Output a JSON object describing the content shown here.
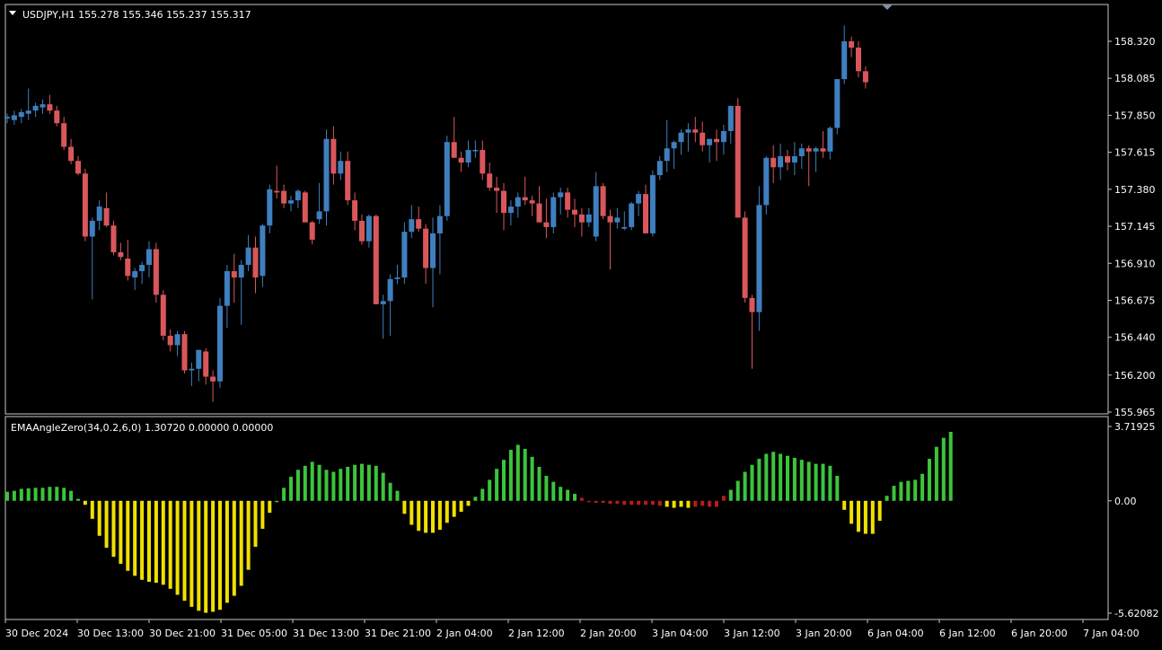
{
  "colors": {
    "background": "#000000",
    "frame": "#c8c8c8",
    "text": "#ffffff",
    "candle_up": "#3f7fbf",
    "candle_down": "#d9575b",
    "hist_green": "#3cc43c",
    "hist_yellow": "#f0e000",
    "hist_red": "#b41c1c"
  },
  "header": {
    "main_title": "USDJPY,H1  155.278 155.346 155.237 155.317",
    "indicator_title": "EMAAngleZero(34,0.2,6,0) 1.30720 0.00000 0.00000"
  },
  "chart_data": [
    {
      "type": "candlestick",
      "title": "USDJPY,H1  155.278 155.346 155.237 155.317",
      "ylim": [
        155.965,
        158.32
      ],
      "y_ticks": [
        "158.320",
        "158.085",
        "157.850",
        "157.615",
        "157.380",
        "157.145",
        "156.910",
        "156.675",
        "156.440",
        "156.200",
        "155.965"
      ],
      "x_ticks": [
        "30 Dec 2024",
        "30 Dec 13:00",
        "30 Dec 21:00",
        "31 Dec 05:00",
        "31 Dec 13:00",
        "31 Dec 21:00",
        "2 Jan 04:00",
        "2 Jan 12:00",
        "2 Jan 20:00",
        "3 Jan 04:00",
        "3 Jan 12:00",
        "3 Jan 20:00",
        "6 Jan 04:00",
        "6 Jan 12:00",
        "6 Jan 20:00",
        "7 Jan 04:00"
      ],
      "ohlc": [
        [
          157.83,
          157.86,
          157.8,
          157.84
        ],
        [
          157.82,
          157.88,
          157.79,
          157.85
        ],
        [
          157.84,
          157.89,
          157.8,
          157.87
        ],
        [
          157.86,
          158.02,
          157.82,
          157.88
        ],
        [
          157.88,
          157.93,
          157.84,
          157.91
        ],
        [
          157.9,
          157.95,
          157.86,
          157.92
        ],
        [
          157.92,
          157.98,
          157.86,
          157.88
        ],
        [
          157.88,
          157.91,
          157.78,
          157.8
        ],
        [
          157.8,
          157.84,
          157.63,
          157.65
        ],
        [
          157.65,
          157.7,
          157.54,
          157.56
        ],
        [
          157.56,
          157.59,
          157.47,
          157.48
        ],
        [
          157.48,
          157.51,
          157.05,
          157.08
        ],
        [
          157.08,
          157.2,
          156.68,
          157.18
        ],
        [
          157.18,
          157.31,
          157.12,
          157.27
        ],
        [
          157.26,
          157.36,
          157.14,
          157.15
        ],
        [
          157.15,
          157.18,
          156.96,
          156.98
        ],
        [
          156.98,
          157.04,
          156.93,
          156.95
        ],
        [
          156.94,
          157.06,
          156.8,
          156.83
        ],
        [
          156.82,
          156.88,
          156.74,
          156.86
        ],
        [
          156.86,
          156.92,
          156.78,
          156.9
        ],
        [
          156.9,
          157.05,
          156.82,
          157.0
        ],
        [
          157.0,
          157.04,
          156.66,
          156.71
        ],
        [
          156.71,
          156.74,
          156.42,
          156.45
        ],
        [
          156.45,
          156.49,
          156.35,
          156.39
        ],
        [
          156.39,
          156.48,
          156.32,
          156.46
        ],
        [
          156.46,
          156.48,
          156.21,
          156.23
        ],
        [
          156.23,
          156.28,
          156.13,
          156.24
        ],
        [
          156.24,
          156.36,
          156.16,
          156.36
        ],
        [
          156.35,
          156.37,
          156.14,
          156.19
        ],
        [
          156.19,
          156.23,
          156.03,
          156.16
        ],
        [
          156.16,
          156.69,
          156.12,
          156.64
        ],
        [
          156.64,
          156.9,
          156.5,
          156.86
        ],
        [
          156.86,
          156.97,
          156.66,
          156.82
        ],
        [
          156.82,
          156.93,
          156.52,
          156.9
        ],
        [
          156.9,
          157.09,
          156.86,
          157.01
        ],
        [
          157.01,
          157.08,
          156.72,
          156.82
        ],
        [
          156.83,
          157.16,
          156.76,
          157.15
        ],
        [
          157.15,
          157.41,
          157.1,
          157.38
        ],
        [
          157.37,
          157.53,
          157.32,
          157.36
        ],
        [
          157.37,
          157.41,
          157.26,
          157.29
        ],
        [
          157.29,
          157.34,
          157.24,
          157.31
        ],
        [
          157.31,
          157.38,
          157.26,
          157.37
        ],
        [
          157.36,
          157.37,
          157.17,
          157.17
        ],
        [
          157.17,
          157.18,
          157.03,
          157.06
        ],
        [
          157.19,
          157.42,
          157.16,
          157.24
        ],
        [
          157.24,
          157.76,
          157.15,
          157.7
        ],
        [
          157.7,
          157.78,
          157.41,
          157.48
        ],
        [
          157.48,
          157.62,
          157.44,
          157.56
        ],
        [
          157.56,
          157.62,
          157.28,
          157.31
        ],
        [
          157.31,
          157.36,
          157.12,
          157.18
        ],
        [
          157.18,
          157.22,
          157.03,
          157.05
        ],
        [
          157.05,
          157.22,
          157.01,
          157.21
        ],
        [
          157.21,
          157.22,
          156.65,
          156.65
        ],
        [
          156.65,
          156.71,
          156.43,
          156.67
        ],
        [
          156.67,
          156.84,
          156.45,
          156.81
        ],
        [
          156.81,
          156.9,
          156.78,
          156.82
        ],
        [
          156.82,
          157.17,
          156.78,
          157.11
        ],
        [
          157.11,
          157.28,
          157.07,
          157.19
        ],
        [
          157.19,
          157.27,
          157.11,
          157.13
        ],
        [
          157.13,
          157.16,
          156.78,
          156.88
        ],
        [
          156.88,
          157.2,
          156.63,
          157.1
        ],
        [
          157.1,
          157.28,
          156.84,
          157.21
        ],
        [
          157.21,
          157.72,
          157.18,
          157.68
        ],
        [
          157.68,
          157.84,
          157.58,
          157.58
        ],
        [
          157.58,
          157.62,
          157.49,
          157.55
        ],
        [
          157.55,
          157.69,
          157.52,
          157.63
        ],
        [
          157.63,
          157.69,
          157.58,
          157.63
        ],
        [
          157.63,
          157.69,
          157.44,
          157.48
        ],
        [
          157.48,
          157.55,
          157.37,
          157.39
        ],
        [
          157.39,
          157.46,
          157.23,
          157.37
        ],
        [
          157.37,
          157.42,
          157.12,
          157.23
        ],
        [
          157.23,
          157.31,
          157.15,
          157.27
        ],
        [
          157.27,
          157.36,
          157.2,
          157.33
        ],
        [
          157.33,
          157.46,
          157.28,
          157.31
        ],
        [
          157.31,
          157.34,
          157.21,
          157.29
        ],
        [
          157.29,
          157.4,
          157.18,
          157.17
        ],
        [
          157.17,
          157.32,
          157.07,
          157.14
        ],
        [
          157.14,
          157.36,
          157.1,
          157.33
        ],
        [
          157.33,
          157.39,
          157.22,
          157.36
        ],
        [
          157.36,
          157.39,
          157.2,
          157.25
        ],
        [
          157.25,
          157.32,
          157.14,
          157.22
        ],
        [
          157.22,
          157.26,
          157.08,
          157.17
        ],
        [
          157.17,
          157.26,
          157.14,
          157.22
        ],
        [
          157.08,
          157.49,
          157.05,
          157.4
        ],
        [
          157.4,
          157.42,
          157.19,
          157.21
        ],
        [
          157.21,
          157.25,
          156.87,
          157.17
        ],
        [
          157.17,
          157.26,
          157.13,
          157.2
        ],
        [
          157.13,
          157.24,
          157.12,
          157.14
        ],
        [
          157.14,
          157.3,
          157.12,
          157.29
        ],
        [
          157.29,
          157.37,
          157.21,
          157.35
        ],
        [
          157.35,
          157.41,
          157.23,
          157.1
        ],
        [
          157.1,
          157.5,
          157.08,
          157.47
        ],
        [
          157.47,
          157.59,
          157.44,
          157.56
        ],
        [
          157.56,
          157.82,
          157.49,
          157.64
        ],
        [
          157.64,
          157.69,
          157.51,
          157.68
        ],
        [
          157.68,
          157.76,
          157.6,
          157.74
        ],
        [
          157.74,
          157.8,
          157.62,
          157.76
        ],
        [
          157.76,
          157.84,
          157.68,
          157.74
        ],
        [
          157.74,
          157.81,
          157.62,
          157.66
        ],
        [
          157.66,
          157.7,
          157.55,
          157.7
        ],
        [
          157.7,
          157.76,
          157.56,
          157.68
        ],
        [
          157.68,
          157.79,
          157.6,
          157.75
        ],
        [
          157.75,
          157.91,
          157.67,
          157.91
        ],
        [
          157.91,
          157.96,
          157.27,
          157.2
        ],
        [
          157.2,
          157.24,
          156.66,
          156.69
        ],
        [
          156.69,
          156.71,
          156.24,
          156.6
        ],
        [
          156.6,
          157.4,
          156.48,
          157.28
        ],
        [
          157.28,
          157.59,
          157.22,
          157.58
        ],
        [
          157.58,
          157.66,
          157.42,
          157.52
        ],
        [
          157.52,
          157.67,
          157.44,
          157.59
        ],
        [
          157.59,
          157.63,
          157.5,
          157.55
        ],
        [
          157.55,
          157.68,
          157.47,
          157.59
        ],
        [
          157.59,
          157.67,
          157.51,
          157.64
        ],
        [
          157.64,
          157.66,
          157.4,
          157.62
        ],
        [
          157.62,
          157.65,
          157.49,
          157.64
        ],
        [
          157.64,
          157.75,
          157.58,
          157.62
        ],
        [
          157.62,
          157.78,
          157.57,
          157.77
        ],
        [
          157.77,
          158.04,
          157.73,
          158.08
        ],
        [
          158.08,
          158.42,
          158.05,
          158.32
        ],
        [
          158.32,
          158.35,
          158.22,
          158.28
        ],
        [
          158.28,
          158.32,
          158.09,
          158.13
        ],
        [
          158.13,
          158.16,
          158.02,
          158.06
        ]
      ]
    },
    {
      "type": "bar",
      "title": "EMAAngleZero(34,0.2,6,0) 1.30720 0.00000 0.00000",
      "ylim": [
        -5.62082,
        3.71925
      ],
      "y_ticks": [
        "3.71925",
        "0.00",
        "-5.62082"
      ],
      "series": [
        {
          "values": [
            0.45,
            0.5,
            0.6,
            0.62,
            0.65,
            0.65,
            0.7,
            0.7,
            0.65,
            0.5,
            0.1,
            -0.2,
            -0.9,
            -1.75,
            -2.35,
            -2.8,
            -3.15,
            -3.5,
            -3.75,
            -3.95,
            -4.05,
            -4.1,
            -4.2,
            -4.4,
            -4.7,
            -5.0,
            -5.3,
            -5.5,
            -5.6,
            -5.55,
            -5.45,
            -5.1,
            -4.75,
            -4.25,
            -3.45,
            -2.3,
            -1.4,
            -0.6,
            0.0,
            0.65,
            1.2,
            1.55,
            1.75,
            1.95,
            1.8,
            1.55,
            1.45,
            1.6,
            1.7,
            1.8,
            1.85,
            1.8,
            1.75,
            1.4,
            0.9,
            0.5,
            -0.65,
            -1.2,
            -1.5,
            -1.6,
            -1.6,
            -1.45,
            -1.1,
            -0.8,
            -0.55,
            -0.25,
            0.2,
            0.6,
            1.05,
            1.6,
            2.05,
            2.55,
            2.8,
            2.6,
            2.2,
            1.7,
            1.25,
            0.95,
            0.7,
            0.55,
            0.35,
            0.15,
            -0.05,
            -0.1,
            -0.1,
            -0.15,
            -0.15,
            -0.2,
            -0.2,
            -0.2,
            -0.2,
            -0.2,
            -0.25,
            -0.3,
            -0.35,
            -0.3,
            -0.35,
            -0.3,
            -0.25,
            -0.3,
            -0.3,
            0.25,
            0.55,
            1.0,
            1.45,
            1.8,
            2.1,
            2.35,
            2.45,
            2.35,
            2.25,
            2.15,
            2.05,
            1.95,
            1.85,
            1.85,
            1.75,
            1.25,
            -0.45,
            -1.15,
            -1.55,
            -1.65,
            -1.65,
            -1.0,
            0.25,
            0.75,
            0.95,
            1.0,
            1.05,
            1.35,
            2.1,
            2.7,
            3.15,
            3.45
          ]
        }
      ]
    }
  ]
}
